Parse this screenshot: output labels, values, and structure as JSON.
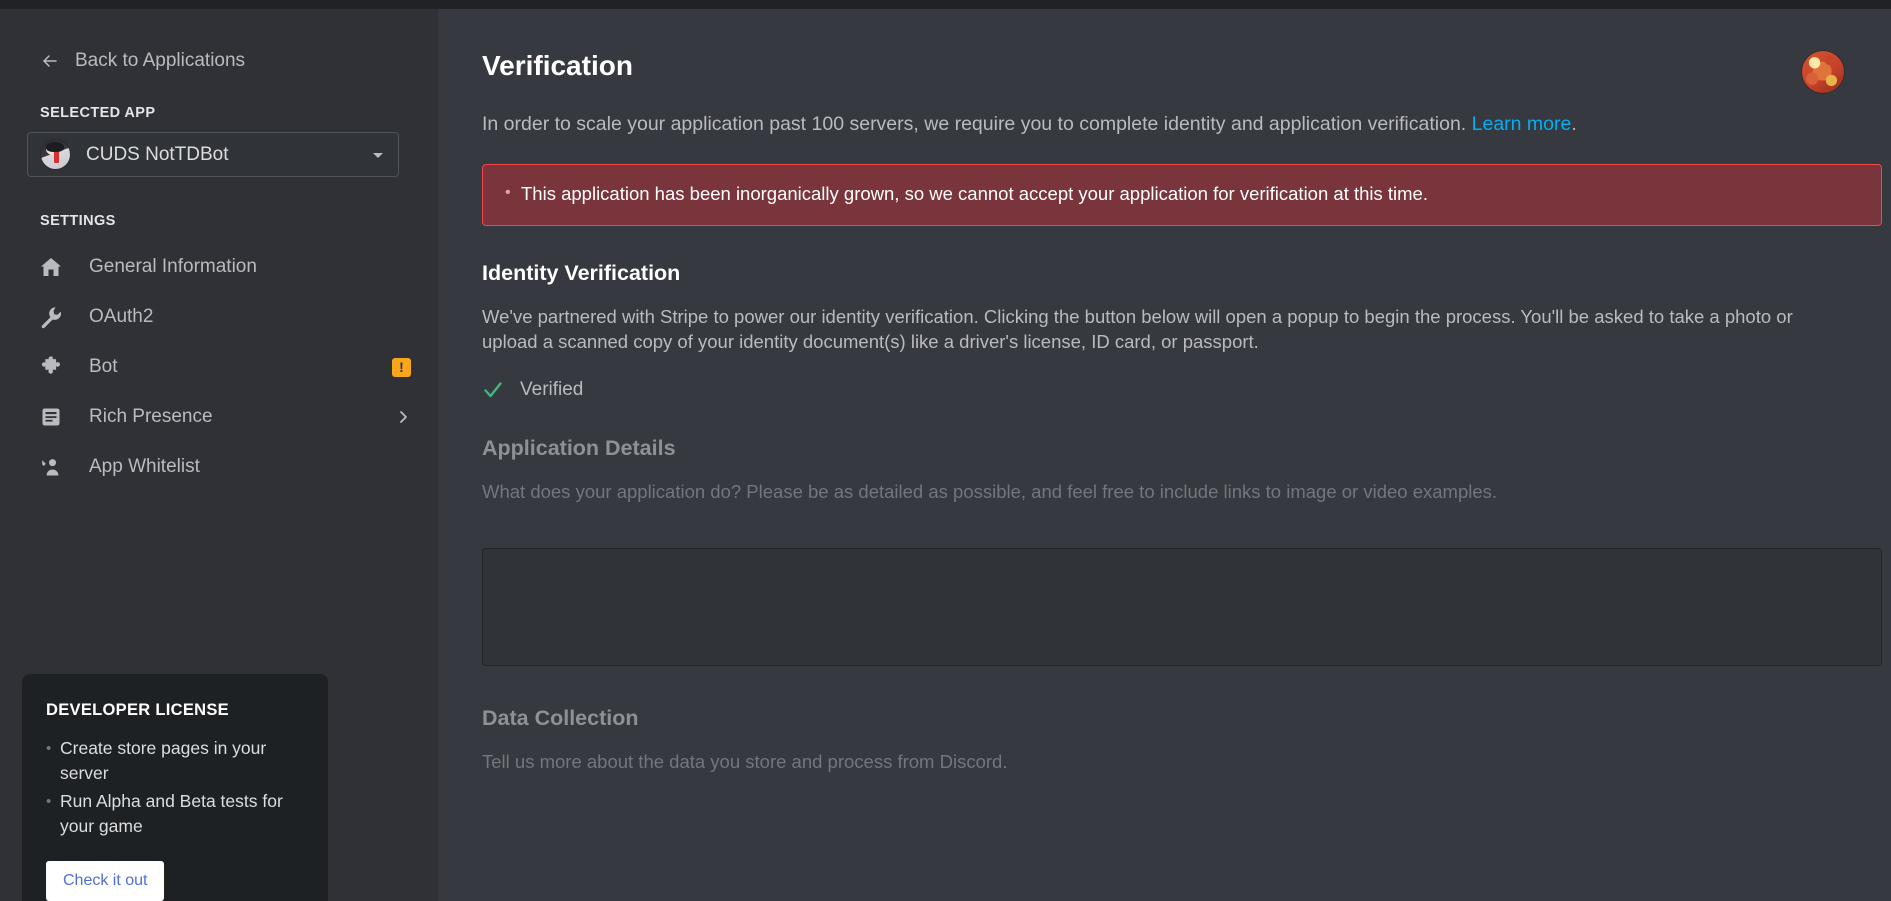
{
  "sidebar": {
    "back_link": "Back to Applications",
    "selected_app_label": "SELECTED APP",
    "selected_app_name": "CUDS NotTDBot",
    "settings_label": "SETTINGS",
    "nav_items": [
      {
        "label": "General Information",
        "icon": "home-icon",
        "badge": null,
        "chevron": false
      },
      {
        "label": "OAuth2",
        "icon": "wrench-icon",
        "badge": null,
        "chevron": false
      },
      {
        "label": "Bot",
        "icon": "puzzle-piece-icon",
        "badge": "!",
        "chevron": false
      },
      {
        "label": "Rich Presence",
        "icon": "list-document-icon",
        "badge": null,
        "chevron": true
      },
      {
        "label": "App Whitelist",
        "icon": "person-add-icon",
        "badge": null,
        "chevron": false
      }
    ],
    "promo": {
      "title": "DEVELOPER LICENSE",
      "bullets": [
        "Create store pages in your server",
        "Run Alpha and Beta tests for your game"
      ],
      "button": "Check it out"
    }
  },
  "main": {
    "page_title": "Verification",
    "intro_before": "In order to scale your application past 100 servers, we require you to complete identity and application verification. ",
    "intro_link": "Learn more",
    "intro_after": ".",
    "error_items": [
      "This application has been inorganically grown, so we cannot accept your application for verification at this time."
    ],
    "identity": {
      "heading": "Identity Verification",
      "body": "We've partnered with Stripe to power our identity verification. Clicking the button below will open a popup to begin the process. You'll be asked to take a photo or upload a scanned copy of your identity document(s) like a driver's license, ID card, or passport.",
      "status": "Verified"
    },
    "application_details": {
      "heading": "Application Details",
      "body": "What does your application do? Please be as detailed as possible, and feel free to include links to image or video examples.",
      "value": "",
      "placeholder": ""
    },
    "data_collection": {
      "heading": "Data Collection",
      "body": "Tell us more about the data you store and process from Discord."
    }
  },
  "colors": {
    "sidebar_bg": "#2f3136",
    "main_bg": "#36393f",
    "error_bg": "#79353b",
    "error_border": "#f04747",
    "link": "#00aff4",
    "verified_green": "#43b581",
    "badge_orange": "#faa61a",
    "promo_bg": "#1e2124"
  }
}
